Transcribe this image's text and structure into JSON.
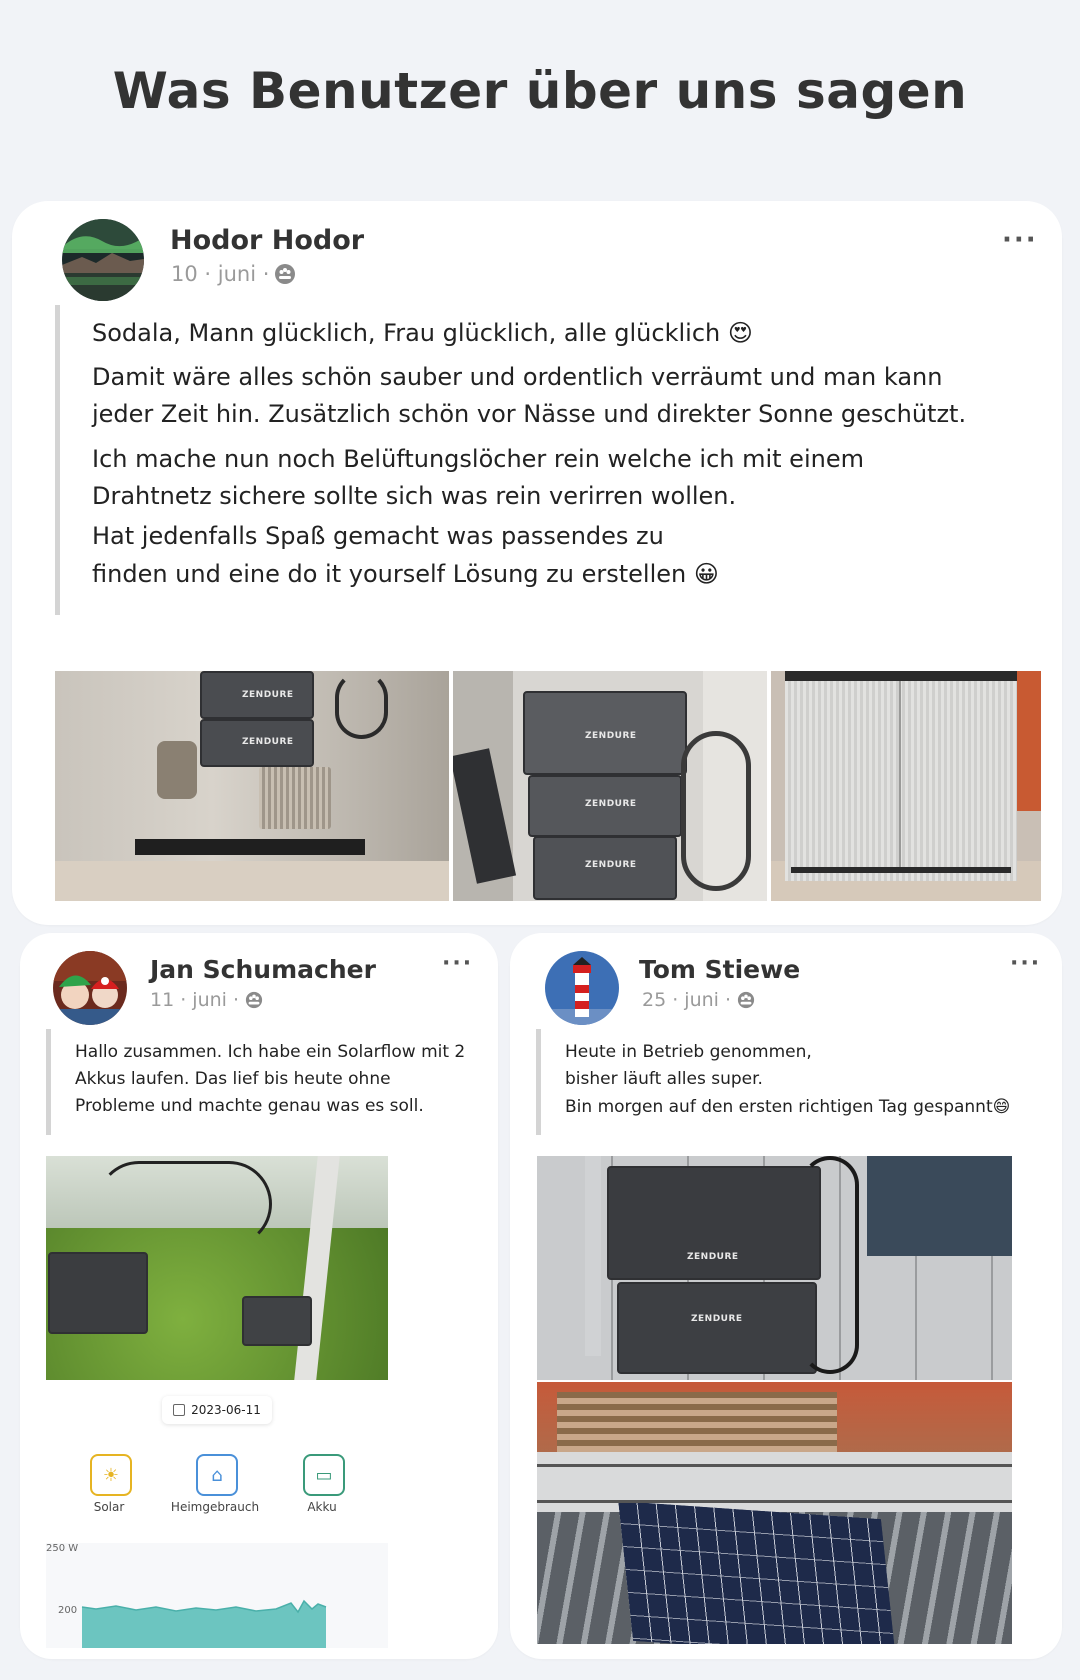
{
  "heading": "Was Benutzer über uns sagen",
  "posts": [
    {
      "author": "Hodor Hodor",
      "date": "10 · juni ·",
      "paragraphs": [
        "Sodala, Mann glücklich, Frau glücklich, alle glücklich 😍",
        "Damit wäre alles schön sauber und ordentlich verräumt und man kann jeder Zeit hin. Zusätzlich schön vor Nässe und direkter Sonne geschützt.",
        "Ich mache nun noch Belüftungslöcher rein welche ich mit einem Drahtnetz sichere sollte sich was rein verirren wollen.",
        "Hat jedenfalls Spaß gemacht was passendes zu",
        "finden und eine do it yourself Lösung zu erstellen 😀"
      ],
      "photo_brand": "ZENDURE"
    },
    {
      "author": "Jan Schumacher",
      "date": "11 · juni ·",
      "text_lines": [
        "Hallo zusammen. Ich habe ein Solarflow mit 2",
        "Akkus laufen. Das lief bis heute ohne",
        "Probleme und machte genau was es soll."
      ],
      "screenshot": {
        "date_chip": "2023-06-11",
        "tabs": [
          "Solar",
          "Heimgebrauch",
          "Akku"
        ],
        "y_ticks": [
          "250 W",
          "200"
        ]
      }
    },
    {
      "author": "Tom Stiewe",
      "date": "25 · juni ·",
      "text_lines": [
        "Heute in Betrieb genommen,",
        "bisher läuft alles super.",
        "Bin morgen auf den ersten richtigen Tag gespannt😄"
      ],
      "photo_brand": "ZENDURE"
    }
  ],
  "more_label": "···",
  "colors": {
    "accent_solar": "#e6b422",
    "accent_home": "#4a90d9",
    "accent_akku": "#3a9a7a",
    "chart_fill": "#6cc5c0"
  }
}
